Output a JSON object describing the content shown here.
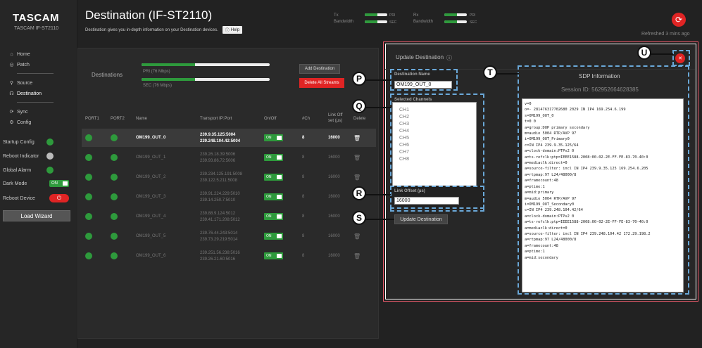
{
  "brand": {
    "name": "TASCAM",
    "model": "TASCAM IF-ST2110"
  },
  "nav": [
    {
      "label": "Home",
      "icon": "home-icon"
    },
    {
      "label": "Patch",
      "icon": "patch-icon"
    },
    {
      "label": "Source",
      "icon": "source-icon"
    },
    {
      "label": "Destination",
      "icon": "destination-icon"
    },
    {
      "label": "Sync",
      "icon": "sync-icon"
    },
    {
      "label": "Config",
      "icon": "config-icon"
    }
  ],
  "status": {
    "startup_config": "Startup Config",
    "reboot_indicator": "Reboot Indicator",
    "global_alarm": "Global Alarm",
    "dark_mode": "Dark Mode",
    "dark_mode_state": "ON",
    "reboot_device": "Reboot Device",
    "load_wizard": "Load Wizard"
  },
  "header": {
    "title": "Destination (IF-ST2110)",
    "subtitle": "Destination gives you in-depth information on your Destination devices.",
    "help": "Help",
    "tx_label": "Tx\nBandwidth",
    "rx_label": "Rx\nBandwidth",
    "pri": "PRI",
    "sec": "SEC",
    "tx_pri_fill": 0.55,
    "tx_sec_fill": 0.55,
    "rx_pri_fill": 0.55,
    "rx_sec_fill": 0.55,
    "refreshed": "Refreshed 3 mins ago"
  },
  "destinations": {
    "label": "Destinations",
    "pri_caption": "PRI (76 Mbps)",
    "sec_caption": "SEC (76 Mbps)",
    "pri_fill": 0.42,
    "sec_fill": 0.42,
    "add_button": "Add Destination",
    "delete_all_button": "Delete All Streams"
  },
  "table": {
    "headers": {
      "port1": "PORT1",
      "port2": "PORT2",
      "name": "Name",
      "transport": "Transport IP:Port",
      "onoff": "On/Off",
      "ch": "#Ch",
      "link_offset": "Link Off\nset (µs)",
      "delete": "Delete"
    },
    "rows": [
      {
        "name": "OM199_OUT_0",
        "ip1": "239.9.35.125:5004",
        "ip2": "239.248.104.42:5004",
        "state": "ON",
        "ch": "8",
        "offset": "16000"
      },
      {
        "name": "OM199_OUT_1",
        "ip1": "239.26.18.39:5006",
        "ip2": "239.93.86.72:5006",
        "state": "ON",
        "ch": "8",
        "offset": "16000"
      },
      {
        "name": "OM199_OUT_2",
        "ip1": "239.234.125.191:5008",
        "ip2": "239.122.5.211:5008",
        "state": "ON",
        "ch": "8",
        "offset": "16000"
      },
      {
        "name": "OM199_OUT_3",
        "ip1": "239.91.224.229:5010",
        "ip2": "239.14.250.7:5010",
        "state": "ON",
        "ch": "8",
        "offset": "16000"
      },
      {
        "name": "OM199_OUT_4",
        "ip1": "239.88.9.124:5012",
        "ip2": "239.41.171.208:5012",
        "state": "ON",
        "ch": "8",
        "offset": "16000"
      },
      {
        "name": "OM199_OUT_5",
        "ip1": "239.76.44.243:5014",
        "ip2": "239.73.29.219:5014",
        "state": "ON",
        "ch": "8",
        "offset": "16000"
      },
      {
        "name": "OM199_OUT_6",
        "ip1": "239.251.56.238:5016",
        "ip2": "239.26.21.60:5016",
        "state": "ON",
        "ch": "8",
        "offset": "16000"
      }
    ]
  },
  "update": {
    "title": "Update Destination",
    "name_label": "Destination Name",
    "name_value": "OM199_OUT_0",
    "channels_label": "Selected Channels",
    "channels": [
      "CH1",
      "CH2",
      "CH3",
      "CH4",
      "CH5",
      "CH6",
      "CH7",
      "CH8"
    ],
    "offset_label": "Link Offset (µs)",
    "offset_value": "16000",
    "button": "Update Destination",
    "callouts": {
      "p": "P",
      "q": "Q",
      "r": "R",
      "s": "S",
      "t": "T",
      "u": "U"
    }
  },
  "sdp": {
    "title": "SDP Information",
    "session": "Session ID: 562952664628385",
    "lines": [
      "v=0",
      "o=- 281476317702680 2029 IN IP4 169.254.6.199",
      "s=OM199_OUT_0",
      "t=0 0",
      "a=group:DUP primary secondary",
      "m=audio 5004 RTP/AVP 97",
      "i=OM199_OUT_Primary0",
      "c=IN IP4 239.9.35.125/64",
      "a=clock-domain:PTPv2 0",
      "a=ts-refclk:ptp=IEEE1588-2008:00-02-2E-FF-FE-83-70-40:0",
      "a=mediaclk:direct=0",
      "a=source-filter: incl IN IP4 239.9.35.125 169.254.6.205",
      "a=rtpmap:97 L24/48000/8",
      "a=framecount:48",
      "a=ptime:1",
      "a=mid:primary",
      "m=audio 5004 RTP/AVP 97",
      "i=OM199_OUT_Secondary0",
      "c=IN IP4 239.248.104.42/64",
      "a=clock-domain:PTPv2 0",
      "a=ts-refclk:ptp=IEEE1588-2008:00-02-2E-FF-FE-83-70-40:0",
      "a=mediaclk:direct=0",
      "a=source-filter: incl IN IP4 239.248.104.42 172.29.198.2",
      "a=rtpmap:97 L24/48000/8",
      "a=framecount:48",
      "a=ptime:1",
      "a=mid:secondary"
    ]
  },
  "colors": {
    "accent_green": "#2e9a3c",
    "alert_red": "#e02424",
    "callout_blue": "#6aa8d8",
    "panel_border": "#e85a6a"
  }
}
